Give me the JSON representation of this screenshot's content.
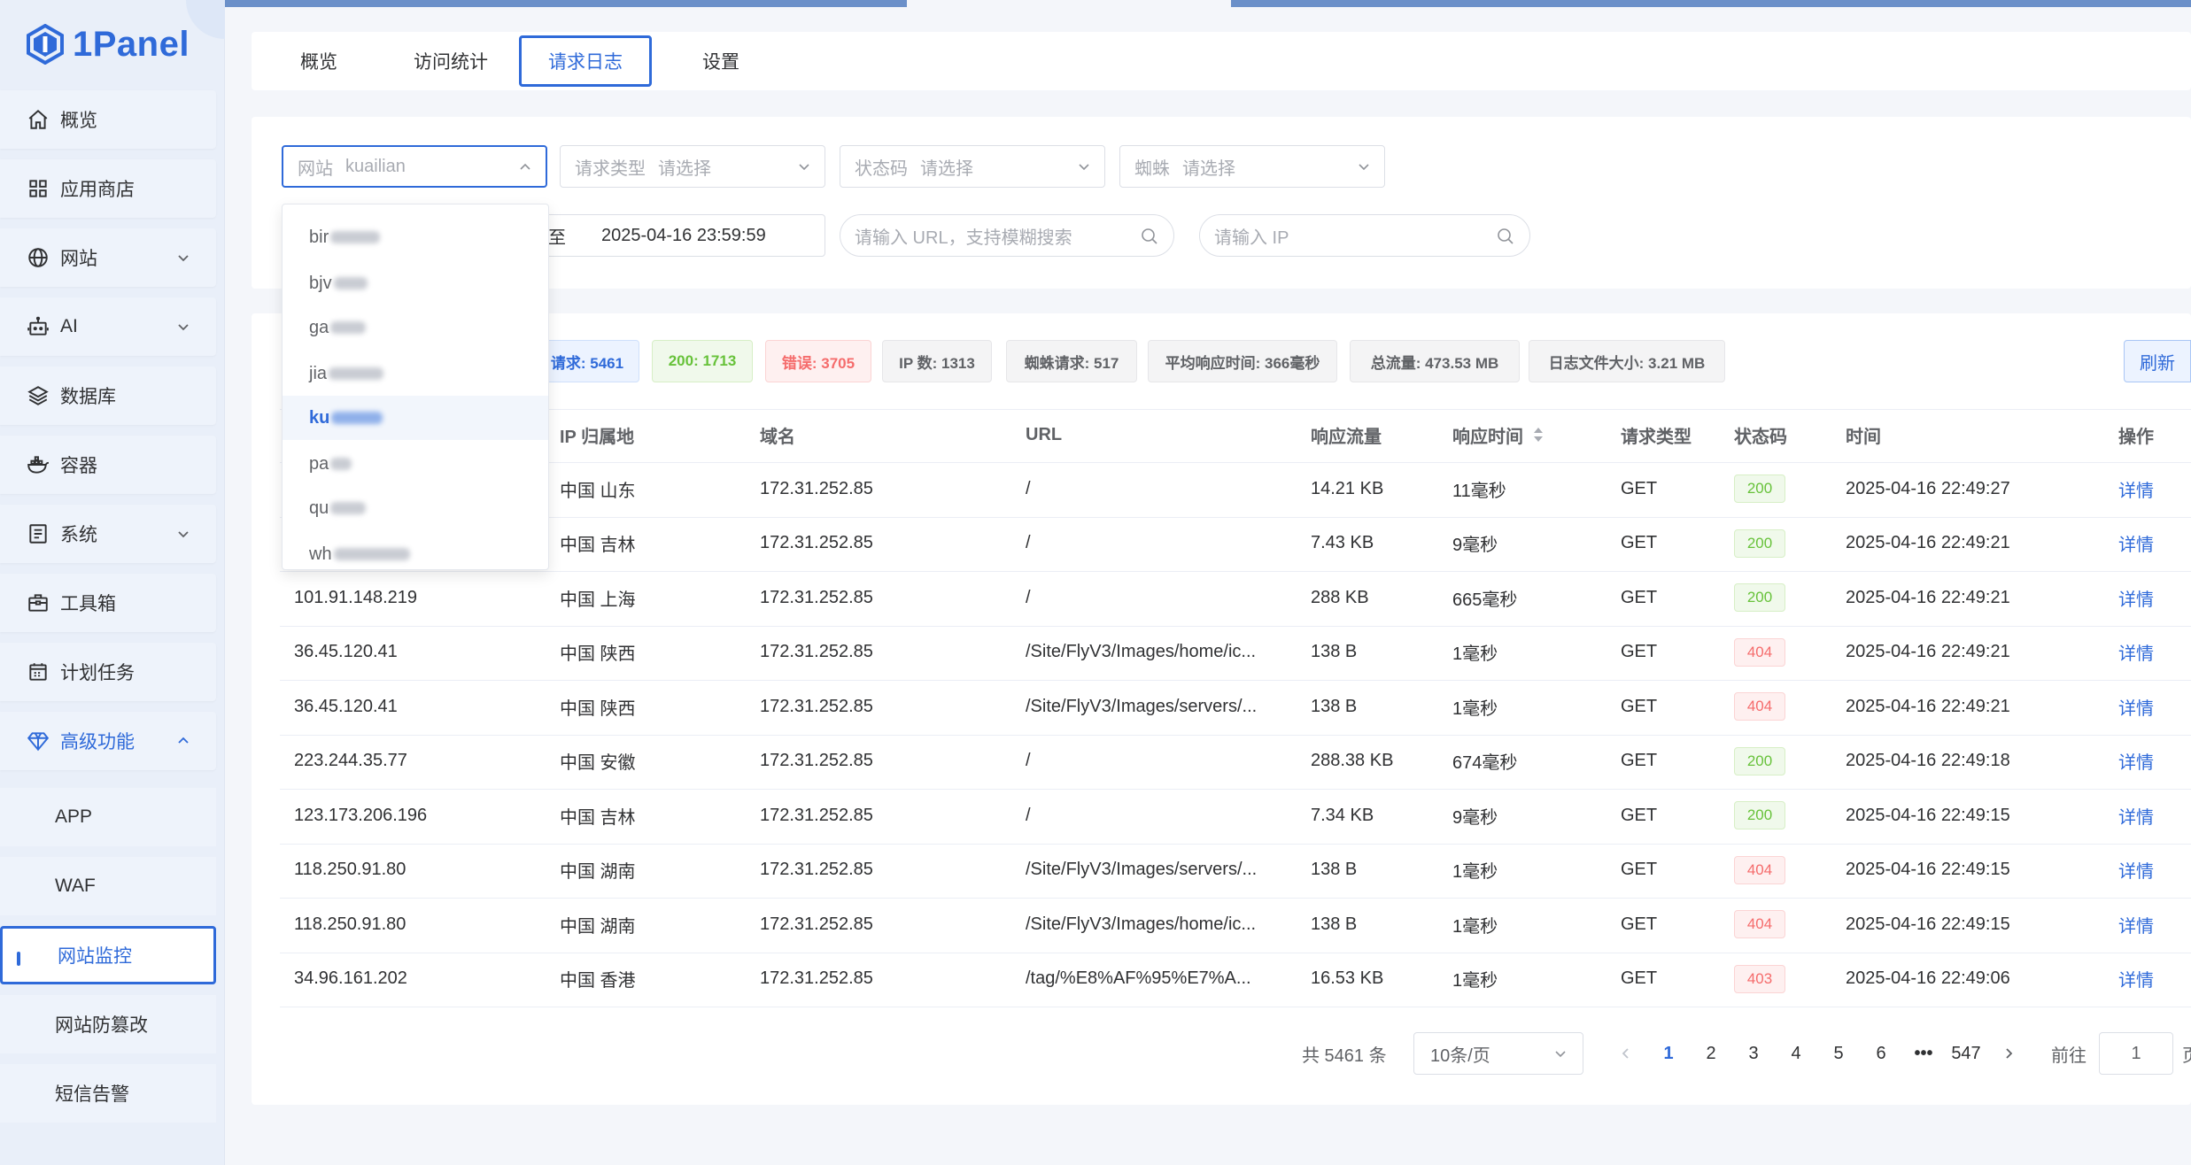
{
  "app": {
    "name": "1Panel"
  },
  "sidebar": {
    "items": [
      {
        "label": "概览",
        "icon": "home-icon"
      },
      {
        "label": "应用商店",
        "icon": "grid-icon"
      },
      {
        "label": "网站",
        "icon": "globe-icon"
      },
      {
        "label": "AI",
        "icon": "robot-icon"
      },
      {
        "label": "数据库",
        "icon": "layers-icon"
      },
      {
        "label": "容器",
        "icon": "docker-icon"
      },
      {
        "label": "系统",
        "icon": "system-icon"
      },
      {
        "label": "工具箱",
        "icon": "toolbox-icon"
      },
      {
        "label": "计划任务",
        "icon": "calendar-icon"
      },
      {
        "label": "高级功能",
        "icon": "diamond-icon"
      }
    ],
    "sub_items": [
      {
        "label": "APP"
      },
      {
        "label": "WAF"
      },
      {
        "label": "网站监控"
      },
      {
        "label": "网站防篡改"
      },
      {
        "label": "短信告警"
      }
    ]
  },
  "tabs": [
    {
      "label": "概览"
    },
    {
      "label": "访问统计"
    },
    {
      "label": "请求日志"
    },
    {
      "label": "设置"
    }
  ],
  "filters": {
    "site": {
      "label": "网站",
      "value": "kuailian"
    },
    "request_type": {
      "label": "请求类型",
      "value": "请选择"
    },
    "status_code": {
      "label": "状态码",
      "value": "请选择"
    },
    "spider": {
      "label": "蜘蛛",
      "value": "请选择"
    },
    "date_separator": "至",
    "date_end": "2025-04-16 23:59:59",
    "url_placeholder": "请输入 URL，支持模糊搜索",
    "ip_placeholder": "请输入 IP"
  },
  "site_dropdown": {
    "options": [
      "bir",
      "bjv",
      "ga",
      "jia",
      "ku",
      "pa",
      "qu",
      "wh"
    ],
    "selected": "ku"
  },
  "stats": [
    {
      "label": "请求: 5461"
    },
    {
      "label": "200: 1713"
    },
    {
      "label": "错误: 3705"
    },
    {
      "label": "IP 数: 1313"
    },
    {
      "label": "蜘蛛请求: 517"
    },
    {
      "label": "平均响应时间: 366毫秒"
    },
    {
      "label": "总流量: 473.53 MB"
    },
    {
      "label": "日志文件大小: 3.21 MB"
    }
  ],
  "refresh_label": "刷新",
  "table": {
    "headers": [
      "IP 归属地",
      "域名",
      "URL",
      "响应流量",
      "响应时间",
      "请求类型",
      "状态码",
      "时间",
      "操作"
    ],
    "rows": [
      {
        "ip": "",
        "loc": "中国 山东",
        "domain": "172.31.252.85",
        "url": "/",
        "size": "14.21 KB",
        "time": "11毫秒",
        "method": "GET",
        "code": "200",
        "date": "2025-04-16 22:49:27",
        "op": "详情"
      },
      {
        "ip": "",
        "loc": "中国 吉林",
        "domain": "172.31.252.85",
        "url": "/",
        "size": "7.43 KB",
        "time": "9毫秒",
        "method": "GET",
        "code": "200",
        "date": "2025-04-16 22:49:21",
        "op": "详情"
      },
      {
        "ip": "101.91.148.219",
        "loc": "中国 上海",
        "domain": "172.31.252.85",
        "url": "/",
        "size": "288 KB",
        "time": "665毫秒",
        "method": "GET",
        "code": "200",
        "date": "2025-04-16 22:49:21",
        "op": "详情"
      },
      {
        "ip": "36.45.120.41",
        "loc": "中国 陕西",
        "domain": "172.31.252.85",
        "url": "/Site/FlyV3/Images/home/ic...",
        "size": "138 B",
        "time": "1毫秒",
        "method": "GET",
        "code": "404",
        "date": "2025-04-16 22:49:21",
        "op": "详情"
      },
      {
        "ip": "36.45.120.41",
        "loc": "中国 陕西",
        "domain": "172.31.252.85",
        "url": "/Site/FlyV3/Images/servers/...",
        "size": "138 B",
        "time": "1毫秒",
        "method": "GET",
        "code": "404",
        "date": "2025-04-16 22:49:21",
        "op": "详情"
      },
      {
        "ip": "223.244.35.77",
        "loc": "中国 安徽",
        "domain": "172.31.252.85",
        "url": "/",
        "size": "288.38 KB",
        "time": "674毫秒",
        "method": "GET",
        "code": "200",
        "date": "2025-04-16 22:49:18",
        "op": "详情"
      },
      {
        "ip": "123.173.206.196",
        "loc": "中国 吉林",
        "domain": "172.31.252.85",
        "url": "/",
        "size": "7.34 KB",
        "time": "9毫秒",
        "method": "GET",
        "code": "200",
        "date": "2025-04-16 22:49:15",
        "op": "详情"
      },
      {
        "ip": "118.250.91.80",
        "loc": "中国 湖南",
        "domain": "172.31.252.85",
        "url": "/Site/FlyV3/Images/servers/...",
        "size": "138 B",
        "time": "1毫秒",
        "method": "GET",
        "code": "404",
        "date": "2025-04-16 22:49:15",
        "op": "详情"
      },
      {
        "ip": "118.250.91.80",
        "loc": "中国 湖南",
        "domain": "172.31.252.85",
        "url": "/Site/FlyV3/Images/home/ic...",
        "size": "138 B",
        "time": "1毫秒",
        "method": "GET",
        "code": "404",
        "date": "2025-04-16 22:49:15",
        "op": "详情"
      },
      {
        "ip": "34.96.161.202",
        "loc": "中国 香港",
        "domain": "172.31.252.85",
        "url": "/tag/%E8%AF%95%E7%A...",
        "size": "16.53 KB",
        "time": "1毫秒",
        "method": "GET",
        "code": "403",
        "date": "2025-04-16 22:49:06",
        "op": "详情"
      }
    ]
  },
  "pagination": {
    "total": "共 5461 条",
    "page_size": "10条/页",
    "pages": [
      "1",
      "2",
      "3",
      "4",
      "5",
      "6",
      "•••",
      "547"
    ],
    "current": "1",
    "goto_label": "前往",
    "goto_value": "1",
    "suffix": "页"
  },
  "colors": {
    "accent": "#2f6ad9",
    "success": "#67c23a",
    "danger": "#f56c6c"
  }
}
